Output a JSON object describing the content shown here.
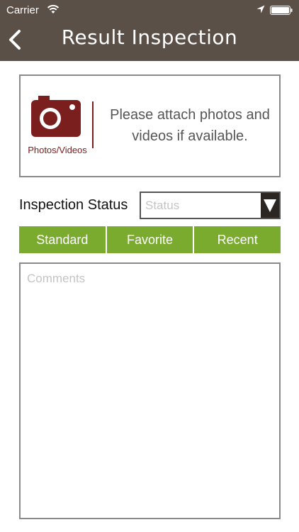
{
  "status_bar": {
    "carrier": "Carrier",
    "icons": [
      "wifi-icon",
      "location-arrow-icon",
      "battery-icon"
    ]
  },
  "header": {
    "title": "Result Inspection",
    "back_icon": "chevron-left-icon",
    "background_color": "#5a5048"
  },
  "attachments": {
    "icon": "camera-icon",
    "icon_label": "Photos/Videos",
    "prompt": "Please attach photos and videos if available.",
    "accent_color": "#7a1e1e"
  },
  "inspection_status": {
    "label": "Inspection Status",
    "placeholder": "Status",
    "dropdown_icon": "triangle-down-icon"
  },
  "tabs": [
    {
      "label": "Standard"
    },
    {
      "label": "Favorite"
    },
    {
      "label": "Recent"
    }
  ],
  "tab_color": "#7aab2f",
  "comments": {
    "placeholder": "Comments"
  }
}
